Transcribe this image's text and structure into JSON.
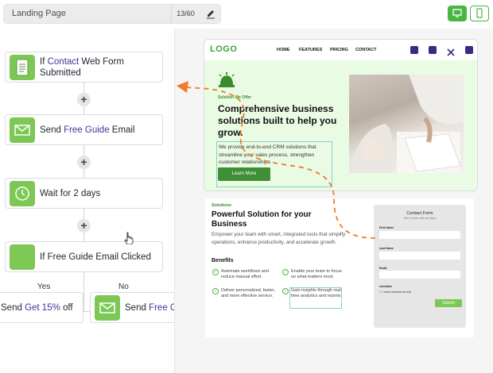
{
  "topbar": {
    "page_name": "Landing Page",
    "char_count": "13/60",
    "edit_icon": "pencil-icon",
    "desktop_icon": "monitor-icon",
    "mobile_icon": "phone-icon"
  },
  "workflow": {
    "steps": [
      {
        "pre": "If ",
        "hl": "Contact",
        "post": " Web Form Submitted",
        "icon": "form-icon"
      },
      {
        "pre": "Send ",
        "hl": "Free Guide",
        "post": " Email",
        "icon": "envelope-icon"
      },
      {
        "pre": "Wait for 2 days",
        "hl": "",
        "post": "",
        "icon": "clock-icon"
      },
      {
        "pre": "If Free Guide Email Clicked",
        "hl": "",
        "post": "",
        "icon": "condition-icon"
      }
    ],
    "yes_label": "Yes",
    "no_label": "No",
    "yes_step": {
      "pre": "Send ",
      "hl": "Get 15%",
      "post": " off"
    },
    "no_step": {
      "pre": "Send ",
      "hl": "Free G",
      "post": ""
    }
  },
  "landing": {
    "logo": "LOGO",
    "nav": [
      "HOME",
      "FEATURES",
      "PRICING",
      "CONTACT"
    ],
    "social_icons": [
      "facebook-icon",
      "instagram-icon",
      "x-icon",
      "linkedin-icon"
    ],
    "offer_tag": "Solution We Offer",
    "headline": "Comprehensive business solutions built to help you grow.",
    "description": "We provide end-to-end CRM solutions that streamline your sales process, strengthen customer relationships",
    "cta": "Learn More"
  },
  "solutions": {
    "tag": "Solutions",
    "title": "Powerful Solution for your Business",
    "description": "Empower your team with smart, integrated tools that simplify operations, enhance productivity, and accelerate growth.",
    "benefits_heading": "Benefits",
    "benefits": [
      "Automate workflows and reduce manual effort.",
      "Enable your team to focus on what matters most.",
      "Deliver personalized, faster, and more effective service.",
      "Gain insights through real-time analytics and reports."
    ]
  },
  "contact_form": {
    "title": "Contact Form",
    "subtitle": "Get in touch with our team",
    "fields": [
      "First Name",
      "Last Name",
      "Email"
    ],
    "checkbox_heading": "checkbox",
    "checkbox_label": "I have read and accept",
    "submit": "Submit"
  },
  "colors": {
    "accent_green": "#7dc855",
    "brand_purple": "#4b2e98",
    "arrow_orange": "#f07a2c"
  }
}
